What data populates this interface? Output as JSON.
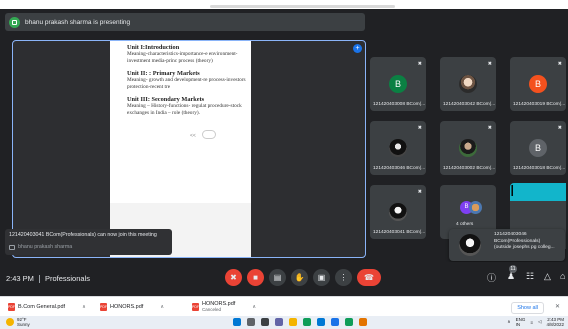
{
  "banner": {
    "text": "bhanu prakash sharma is presenting"
  },
  "document": {
    "unit1_title": "Unit I:Introduction",
    "unit1_body": "Meaning-characteristics-importance-e environment- investment media-princ process (theory)",
    "unit2_title": "Unit II: : Primary Markets",
    "unit2_body": "Meaning- growth and development-re process-investors protection-recent tre",
    "unit3_title": "Unit III: Secondary Markets",
    "unit3_body": "Meaning – History-functions- regulat procedure-stock exchanges in India – role (theory).",
    "page_indicator": "<<"
  },
  "toast": {
    "message": "121420403041 BCom(Professionals) can now join this meeting",
    "presenter": "bhanu prakash sharma"
  },
  "participants": [
    {
      "initial": "B",
      "name": "121420403008 BCom(...",
      "color": "#0b8043",
      "kind": "letter"
    },
    {
      "initial": "",
      "name": "121420403042 BCom(...",
      "color": "",
      "kind": "photo"
    },
    {
      "initial": "B",
      "name": "121420403019 BCom(...",
      "color": "#f4511e",
      "kind": "letter"
    },
    {
      "initial": "",
      "name": "121420403046 BCom(...",
      "color": "",
      "kind": "photo2"
    },
    {
      "initial": "",
      "name": "121420403002 BCom(...",
      "color": "",
      "kind": "photo3"
    },
    {
      "initial": "B",
      "name": "121420403018 BCom(...",
      "color": "#5f6368",
      "kind": "letter"
    },
    {
      "initial": "",
      "name": "121420403041 BCom(...",
      "color": "",
      "kind": "photo3"
    },
    {
      "initial": "B",
      "name": "4 others",
      "color": "#7e3ff2",
      "kind": "others"
    },
    {
      "initial": "I",
      "name": "",
      "color": "#12b5cb",
      "kind": "letter"
    }
  ],
  "tooltip": {
    "line1": "121420403046",
    "line2": "BCom(Professionals)",
    "line3": "(outside josephs pg colleg..."
  },
  "controls": {
    "time": "2:43 PM",
    "meeting_name": "Professionals",
    "people_count": "11"
  },
  "downloads": [
    {
      "name": "B.Com General.pdf",
      "sub": ""
    },
    {
      "name": "HONORS.pdf",
      "sub": ""
    },
    {
      "name": "HONORS.pdf",
      "sub": "Canceled"
    }
  ],
  "downloads_show_all": "Show all",
  "taskbar": {
    "temp": "92°F",
    "weather": "Sunny",
    "lang1": "ENG",
    "lang2": "IN",
    "clock_time": "2:43 PM",
    "clock_date": "4/8/2022"
  },
  "colors": {
    "accent": "#8ab4f8",
    "end_call": "#ea4335",
    "meet_bg": "#202124"
  }
}
